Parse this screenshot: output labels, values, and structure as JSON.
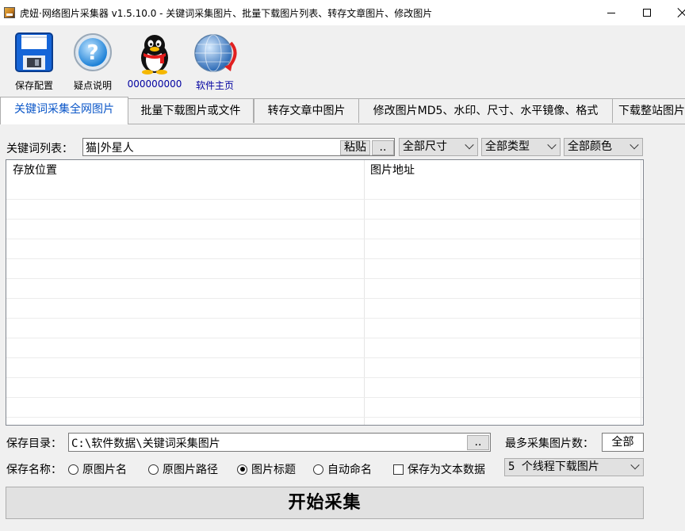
{
  "window": {
    "title": "虎妞·网络图片采集器 v1.5.10.0 - 关键词采集图片、批量下载图片列表、转存文章图片、修改图片"
  },
  "toolbar": {
    "save_label": "保存配置",
    "help_label": "疑点说明",
    "qq_label": "000000000",
    "home_label": "软件主页"
  },
  "tabs": [
    {
      "label": "关键词采集全网图片",
      "active": true
    },
    {
      "label": "批量下载图片或文件",
      "active": false
    },
    {
      "label": "转存文章中图片",
      "active": false
    },
    {
      "label": "修改图片MD5、水印、尺寸、水平镜像、格式",
      "active": false
    },
    {
      "label": "下载整站图片",
      "active": false
    }
  ],
  "keywords": {
    "label": "关键词列表：",
    "value": "猫|外星人",
    "paste_label": "粘贴",
    "browse_label": ".."
  },
  "filters": {
    "size": "全部尺寸",
    "type": "全部类型",
    "color": "全部颜色"
  },
  "list": {
    "columns": [
      "存放位置",
      "图片地址"
    ],
    "rows": []
  },
  "save_dir": {
    "label": "保存目录：",
    "value": "C:\\软件数据\\关键词采集图片",
    "browse_label": ".."
  },
  "max_count": {
    "label": "最多采集图片数：",
    "value": "全部"
  },
  "save_name": {
    "label": "保存名称：",
    "options": [
      "原图片名",
      "原图片路径",
      "图片标题",
      "自动命名"
    ],
    "selected": "图片标题",
    "save_as_text_label": "保存为文本数据",
    "save_as_text_checked": false
  },
  "threads": {
    "value": "5 个线程下载图片"
  },
  "start_button": "开始采集",
  "colors": {
    "active_tab_text": "#0a56c8",
    "link_text": "#0000a0"
  }
}
